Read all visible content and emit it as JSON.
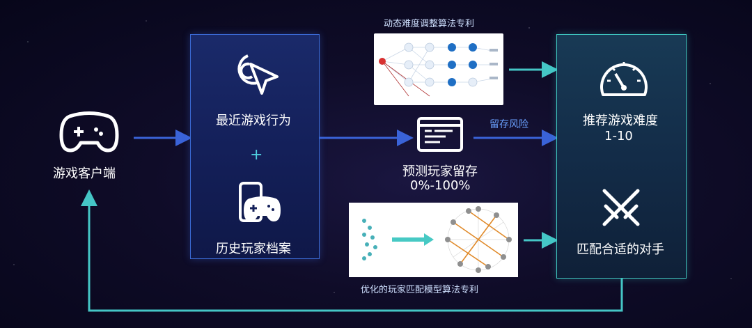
{
  "nodes": {
    "client": "游戏客户端",
    "recent_behavior": "最近游戏行为",
    "plus": "+",
    "history_profile": "历史玩家档案",
    "predict_retention": "预测玩家留存",
    "retention_range": "0%-100%",
    "retention_risk": "留存风险",
    "recommend_difficulty": "推荐游戏难度",
    "difficulty_range": "1-10",
    "match_opponent": "匹配合适的对手",
    "patent_difficulty": "动态难度调整算法专利",
    "patent_matching": "优化的玩家匹配模型算法专利"
  },
  "colors": {
    "arrow_blue": "#3a63d8",
    "arrow_cyan": "#45c6c6",
    "panel_mid_border": "#3b6bd6",
    "panel_right_border": "#3fc7c0"
  },
  "icons": [
    "gamepad-icon",
    "cursor-target-icon",
    "phone-gamepad-icon",
    "terminal-icon",
    "speedometer-icon",
    "crossed-swords-icon"
  ]
}
